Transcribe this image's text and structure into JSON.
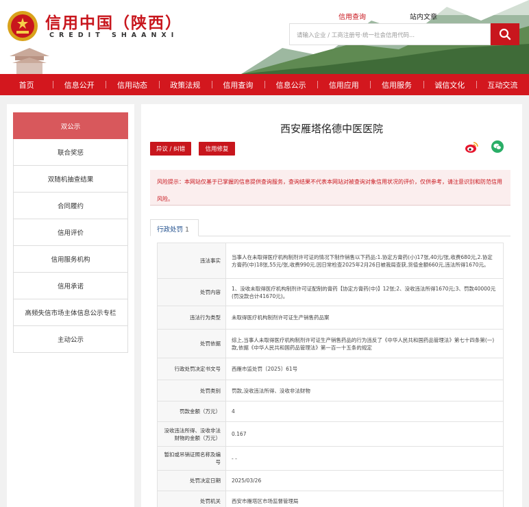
{
  "header": {
    "title": "信用中国（陕西）",
    "subtitle": "CREDIT SHAANXI",
    "search_tabs": [
      "信用查询",
      "站内文章"
    ],
    "search_placeholder": "请输入企业 / 工商注册号·统一社会信用代码...",
    "search_icon": "search-icon"
  },
  "nav": [
    "首页",
    "信息公开",
    "信用动态",
    "政策法规",
    "信用查询",
    "信息公示",
    "信用应用",
    "信用服务",
    "诚信文化",
    "互动交流"
  ],
  "sidebar": [
    {
      "label": "双公示",
      "active": true
    },
    {
      "label": "联合奖惩",
      "active": false
    },
    {
      "label": "双随机抽查结果",
      "active": false
    },
    {
      "label": "合同履约",
      "active": false
    },
    {
      "label": "信用评价",
      "active": false
    },
    {
      "label": "信用服务机构",
      "active": false
    },
    {
      "label": "信用承诺",
      "active": false
    },
    {
      "label": "高频失信市场主体信息公示专栏",
      "active": false
    },
    {
      "label": "主动公示",
      "active": false
    }
  ],
  "main": {
    "org_name": "西安雁塔佲德中医医院",
    "buttons": {
      "objection": "异议 / 纠错",
      "repair": "信用修复"
    },
    "share_icons": [
      "weibo-icon",
      "wechat-icon"
    ],
    "risk_notice": "风险提示：本网站仅基于已掌握的信息提供查询服务，查询结果不代表本网站对被查询对象信用状况的评价，仅供参考，请注意识别和防范信用风险。",
    "tab": {
      "label": "行政处罚",
      "count": "1"
    }
  },
  "record": [
    {
      "label": "违法事实",
      "value": "当事人在未取得医疗机构制剂许可证的情况下制作销售以下药品:1.协定方膏药(小)17张,40元/张,收费680元,2.协定方膏药(中)18张,55元/张,收费990元.因日常检查2025年2月26日被我局查获,货值金额660元,违法所得1670元。"
    },
    {
      "label": "处罚内容",
      "value": "1、没收未取得医疗机构制剂许可证配制的膏药【协定方膏药(中)】12张;2、没收违法所得1670元;3、罚款40000元(罚没款合计41670元)。"
    },
    {
      "label": "违法行为类型",
      "value": "未取得医疗机构制剂许可证生产销售药品案"
    },
    {
      "label": "处罚依据",
      "value": "综上,当事人未取得医疗机构制剂许可证生产销售药品的行为违反了《中华人民共和国药品管理法》第七十四条第(一)款,依据《中华人民共和国药品管理法》第一百一十五条的规定"
    },
    {
      "label": "行政处罚决定书文号",
      "value": "西雁市监处罚〔2025〕61号"
    },
    {
      "label": "处罚类别",
      "value": "罚款,没收违法所得、没收非法财物"
    },
    {
      "label": "罚款金额（万元）",
      "value": "4"
    },
    {
      "label": "没收违法所得、没收非法财物的金额（万元）",
      "value": "0.167"
    },
    {
      "label": "暂扣或吊销证照名称及编号",
      "value": "- -"
    },
    {
      "label": "处罚决定日期",
      "value": "2025/03/26"
    },
    {
      "label": "处罚机关",
      "value": "西安市雁塔区市场监督管理局"
    }
  ],
  "colors": {
    "brand_red": "#c8161d",
    "nav_red": "#d3171e",
    "sidebar_active": "#d8585c"
  }
}
